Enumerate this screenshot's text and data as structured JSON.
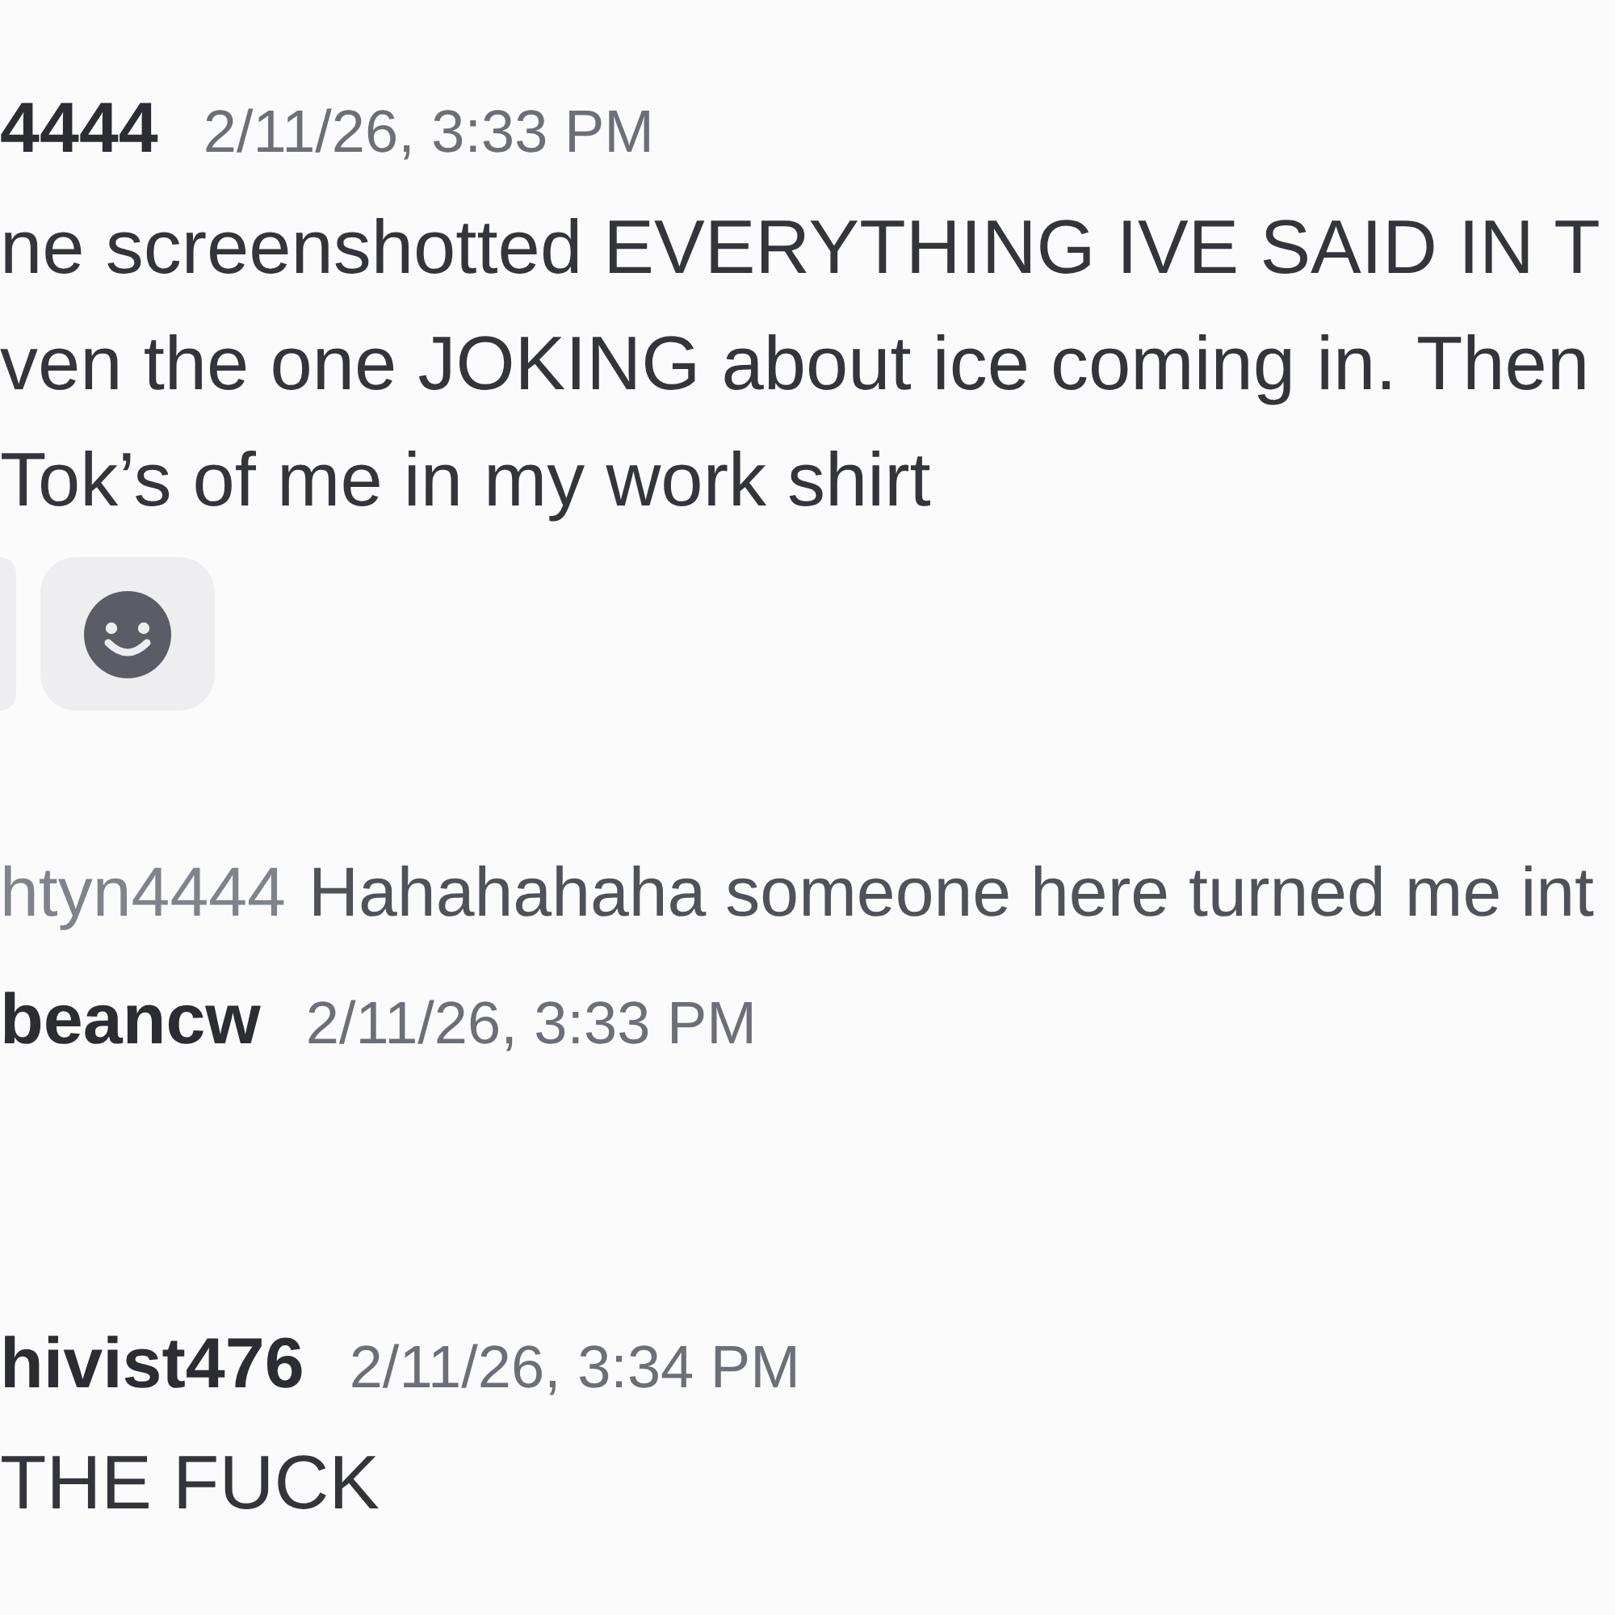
{
  "messages": [
    {
      "author": "4444",
      "timestamp": "2/11/26, 3:33 PM",
      "lines": [
        "ne screenshotted EVERYTHING IVE SAID IN T",
        "ven the one JOKING about ice coming in. Then",
        "Tok’s of me in my work shirt"
      ],
      "reactions": [
        {
          "kind": "pill"
        },
        {
          "kind": "add"
        }
      ]
    },
    {
      "reply": {
        "author": "htyn4444",
        "text": "Hahahahaha someone here turned me int"
      },
      "author": "beancw",
      "timestamp": "2/11/26, 3:33 PM"
    },
    {
      "author": "hivist476",
      "timestamp": "2/11/26, 3:34 PM",
      "lines": [
        "THE FUCK"
      ]
    }
  ]
}
